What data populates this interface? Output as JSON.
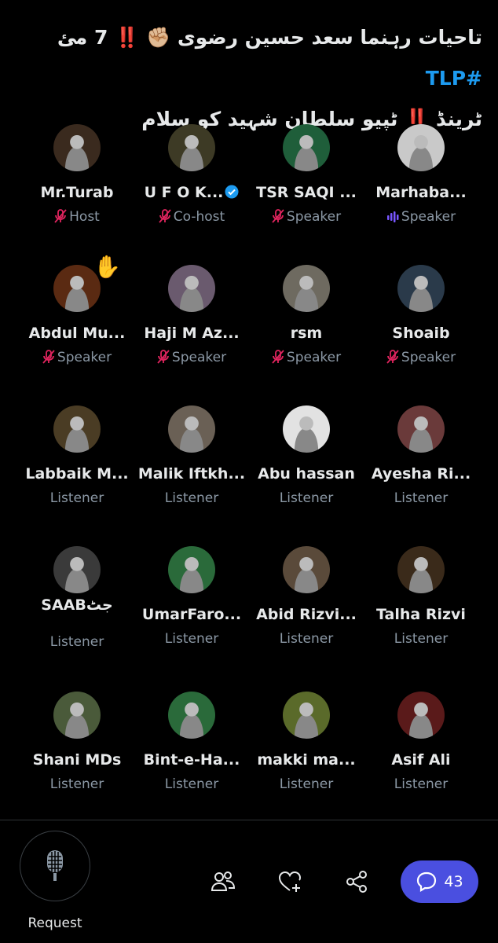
{
  "space": {
    "title_line1_prefix": "تاحیات رہنما سعد حسین رضوی",
    "title_line1_suffix": "7 مئ",
    "hashtag": "#TLP",
    "title_line2": "ٹپیو سلطان شہید کو سلام",
    "title_line2_prefix": "ٹرینڈ"
  },
  "participants": [
    {
      "name": "Mr.Turab",
      "role": "Host",
      "mic": "muted",
      "avatar_color": "#3a2a1e"
    },
    {
      "name": "U F O K...",
      "role": "Co-host",
      "mic": "muted",
      "verified": true,
      "avatar_color": "#3d3a25"
    },
    {
      "name": "TSR SAQI ...",
      "role": "Speaker",
      "mic": "muted",
      "avatar_color": "#1f5e3a"
    },
    {
      "name": "Marhaba...",
      "role": "Speaker",
      "mic": "speaking",
      "avatar_color": "#c9c9c9"
    },
    {
      "name": "Abdul Mu...",
      "role": "Speaker",
      "mic": "muted",
      "hand_raised": true,
      "avatar_color": "#5a2a12"
    },
    {
      "name": "Haji M Az...",
      "role": "Speaker",
      "mic": "muted",
      "avatar_color": "#6a5a6e"
    },
    {
      "name": "rsm",
      "role": "Speaker",
      "mic": "muted",
      "avatar_color": "#6e6a60"
    },
    {
      "name": "Shoaib",
      "role": "Speaker",
      "mic": "muted",
      "avatar_color": "#2a3a4a"
    },
    {
      "name": "Labbaik M...",
      "role": "Listener",
      "avatar_color": "#4a3c24"
    },
    {
      "name": "Malik Iftkh...",
      "role": "Listener",
      "avatar_color": "#6a6055"
    },
    {
      "name": "Abu hassan",
      "role": "Listener",
      "avatar_color": "#e2e2e2"
    },
    {
      "name": "Ayesha Ri...",
      "role": "Listener",
      "avatar_color": "#6a3a3a"
    },
    {
      "name": "SAABجٹ",
      "role": "Listener",
      "avatar_color": "#3a3a3a"
    },
    {
      "name": "UmarFaro...",
      "role": "Listener",
      "avatar_color": "#2a6a3a"
    },
    {
      "name": "Abid Rizvi...",
      "role": "Listener",
      "avatar_color": "#5a4a3a"
    },
    {
      "name": "Talha Rizvi",
      "role": "Listener",
      "avatar_color": "#3a2a1a"
    },
    {
      "name": "Shani MDs",
      "role": "Listener",
      "avatar_color": "#4a5a3a"
    },
    {
      "name": "Bint-e-Ha...",
      "role": "Listener",
      "avatar_color": "#2a6a3a"
    },
    {
      "name": "makki ma...",
      "role": "Listener",
      "avatar_color": "#5a6a2a"
    },
    {
      "name": "Asif Ali",
      "role": "Listener",
      "avatar_color": "#5a1a1a"
    }
  ],
  "footer": {
    "request_label": "Request",
    "chat_count": "43",
    "icons": [
      "microphone-icon",
      "people-icon",
      "heart-plus-icon",
      "share-icon",
      "chat-bubble-icon"
    ]
  },
  "colors": {
    "accent": "#1d9bf0",
    "muted_mic": "#e0245e",
    "speaking": "#7856ff",
    "chat_button": "#4a4fe0"
  }
}
